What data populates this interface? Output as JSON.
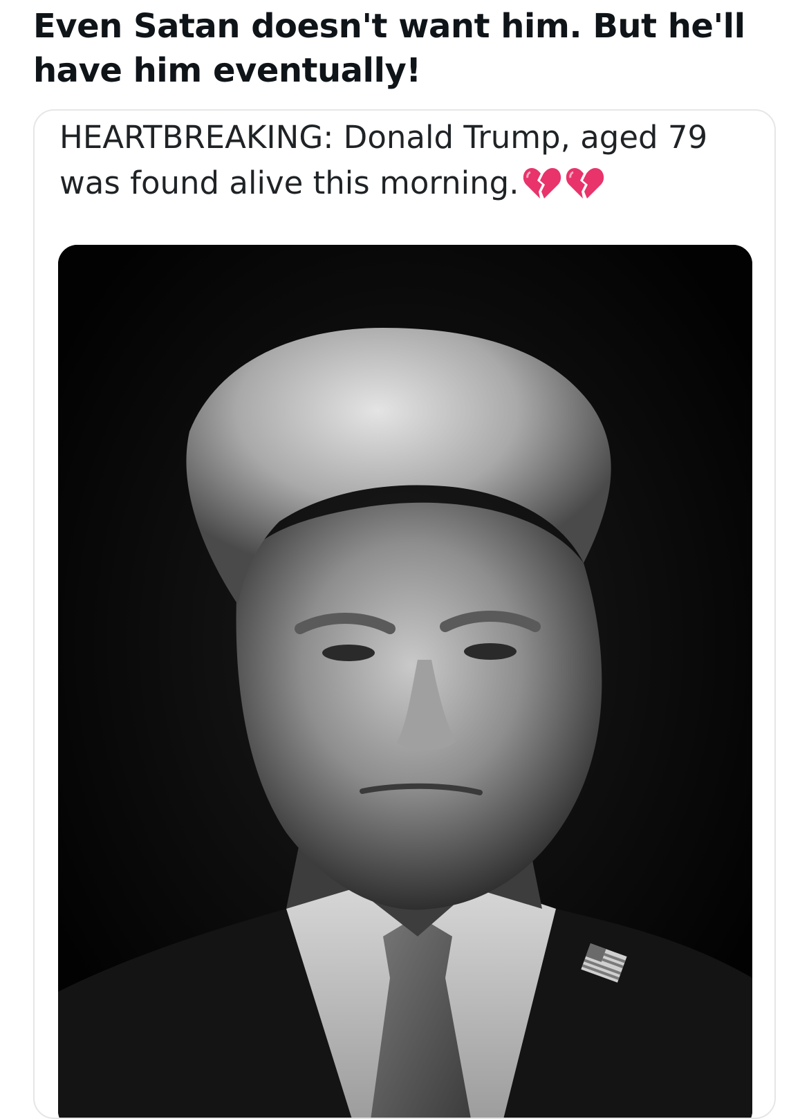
{
  "post": {
    "caption": "Even Satan doesn't want him. But he'll have him eventually!"
  },
  "quoted_tweet": {
    "text": "HEARTBREAKING: Donald Trump, aged 79 was found alive this morning.",
    "emoji_icons": [
      "broken-heart-icon",
      "broken-heart-icon"
    ],
    "emoji_color": "#e8336b"
  },
  "photo": {
    "style": "black-and-white portrait",
    "background_color": "#050505"
  }
}
